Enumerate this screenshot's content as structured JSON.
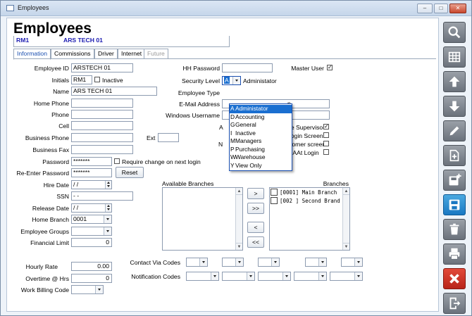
{
  "window": {
    "title": "Employees"
  },
  "page_title": "Employees",
  "header": {
    "code": "RM1",
    "name": "ARS TECH 01"
  },
  "tabs": [
    {
      "label": "Information",
      "active": true
    },
    {
      "label": "Commissions",
      "active": false
    },
    {
      "label": "Driver",
      "active": false
    },
    {
      "label": "Internet",
      "active": false
    },
    {
      "label": "Future",
      "disabled": true
    }
  ],
  "left": {
    "employee_id": {
      "label": "Employee ID",
      "value": "ARSTECH 01"
    },
    "initials": {
      "label": "Initials",
      "value": "RM1",
      "inactive_label": "Inactive"
    },
    "name": {
      "label": "Name",
      "value": "ARS TECH 01"
    },
    "home_phone": {
      "label": "Home Phone",
      "value": ""
    },
    "phone": {
      "label": "Phone",
      "value": ""
    },
    "cell": {
      "label": "Cell",
      "value": ""
    },
    "business_phone": {
      "label": "Business Phone",
      "value": "",
      "ext_label": "Ext"
    },
    "business_fax": {
      "label": "Business Fax",
      "value": ""
    },
    "password": {
      "label": "Password",
      "value": "*******",
      "require_label": "Require change on next login"
    },
    "reenter": {
      "label": "Re-Enter Password",
      "value": "*******",
      "reset_label": "Reset"
    },
    "hire_date": {
      "label": "Hire Date",
      "value": "/ /"
    },
    "ssn": {
      "label": "SSN",
      "value": "- -"
    },
    "release_date": {
      "label": "Release Date",
      "value": "/ /"
    },
    "home_branch": {
      "label": "Home Branch",
      "value": "0001"
    },
    "employee_groups": {
      "label": "Employee Groups",
      "value": ""
    },
    "financial_limit": {
      "label": "Financial Limit",
      "value": "0"
    },
    "hourly_rate": {
      "label": "Hourly Rate",
      "value": "0.00"
    },
    "overtime": {
      "label": "Overtime @ Hrs",
      "value": "0"
    },
    "work_billing": {
      "label": "Work Billing Code",
      "value": ""
    }
  },
  "middle": {
    "hh_password": {
      "label": "HH Password",
      "value": ""
    },
    "master_user": {
      "label": "Master User",
      "checked": true
    },
    "security_level": {
      "label": "Security Level",
      "value": "A",
      "display": "Administator"
    },
    "employee_type": {
      "label": "Employee Type",
      "value": ""
    },
    "email": {
      "label": "E-Mail Address",
      "value_suffix": "n"
    },
    "windows_username": {
      "label": "Windows Username",
      "value": ""
    },
    "partial_labels": [
      {
        "text": "A",
        "checked": null
      },
      {
        "text": "ile Supervisor",
        "checked": true
      },
      {
        "text": "Login Screen",
        "checked": false
      },
      {
        "text": "N",
        "checked": null
      },
      {
        "text": "tomer screen",
        "checked": false
      },
      {
        "text": "DMAAt Login",
        "checked": false
      }
    ]
  },
  "security_dropdown": {
    "items": [
      {
        "code": "A",
        "label": "Administator",
        "selected": true
      },
      {
        "code": "D",
        "label": "Accounting"
      },
      {
        "code": "G",
        "label": "General"
      },
      {
        "code": "I",
        "label": "Inactive"
      },
      {
        "code": "M",
        "label": "Managers"
      },
      {
        "code": "P",
        "label": "Purchasing"
      },
      {
        "code": "W",
        "label": "Warehouse"
      },
      {
        "code": "Y",
        "label": "View Only"
      }
    ]
  },
  "branches": {
    "available_label": "Available Branches",
    "selected_label": "Branches",
    "selected": [
      "[0001] Main Branch",
      "[002 ] Second Brand"
    ],
    "move_buttons": [
      ">",
      ">>",
      "<",
      "<<"
    ]
  },
  "contact": {
    "via_label": "Contact Via Codes",
    "notif_label": "Notification Codes"
  },
  "toolbar": [
    {
      "name": "search-icon",
      "color": "#7d848d"
    },
    {
      "name": "grid-icon",
      "color": "#7d848d"
    },
    {
      "name": "arrow-up-icon",
      "color": "#7d848d"
    },
    {
      "name": "arrow-down-icon",
      "color": "#7d848d"
    },
    {
      "name": "pencil-icon",
      "color": "#7d848d"
    },
    {
      "name": "new-document-icon",
      "color": "#7d848d"
    },
    {
      "name": "add-save-icon",
      "color": "#7d848d"
    },
    {
      "name": "save-icon",
      "color": "#1a78c2"
    },
    {
      "name": "trash-icon",
      "color": "#7d848d"
    },
    {
      "name": "print-icon",
      "color": "#7d848d"
    },
    {
      "name": "cancel-x-icon",
      "color": "#c8271b"
    },
    {
      "name": "exit-icon",
      "color": "#7d848d"
    }
  ]
}
